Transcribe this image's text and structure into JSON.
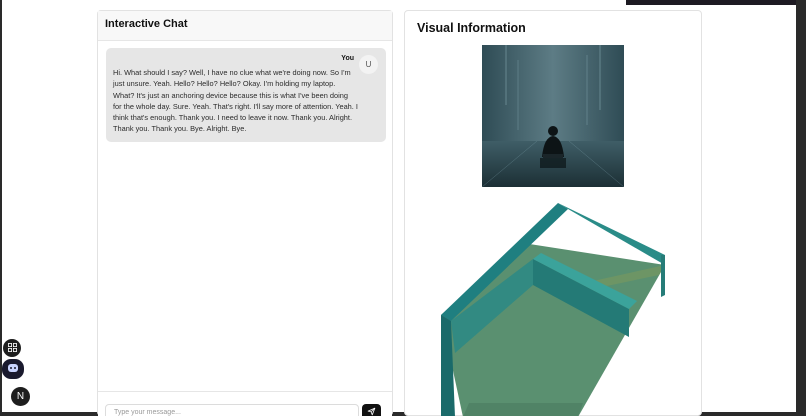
{
  "chat": {
    "title": "Interactive Chat",
    "message": {
      "sender": "You",
      "avatar_initial": "U",
      "text": "Hi. What should I say? Well, I have no clue what we're doing now. So I'm just unsure. Yeah. Hello? Hello? Hello? Okay. I'm holding my laptop. What? It's just an anchoring device because this is what I've been doing for the whole day. Sure. Yeah. That's right. I'll say more of attention. Yeah. I think that's enough. Thank you. I need to leave it now. Thank you. Alright. Thank you. Thank you. Bye. Alright. Bye."
    },
    "input": {
      "placeholder": "Type your message..."
    }
  },
  "visual": {
    "title": "Visual Information"
  },
  "floating": {
    "n_label": "N"
  },
  "icons": {
    "send": "send-icon",
    "grid": "grid-icon",
    "bot": "bot-icon"
  },
  "colors": {
    "message_bubble": "#e6e6e6",
    "send_button": "#111111",
    "render_teal": "#1f7f80",
    "render_floor": "#5a9070"
  }
}
